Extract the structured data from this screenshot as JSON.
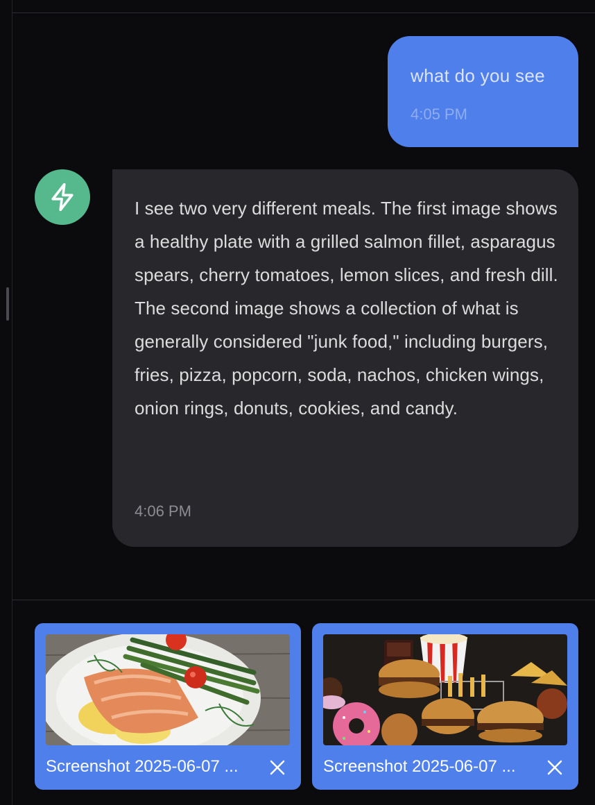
{
  "conversation": {
    "user_message": {
      "text": "what do you see",
      "time": "4:05 PM"
    },
    "assistant_message": {
      "avatar_icon": "lightning-bolt-icon",
      "text": "I see two very different meals. The first image shows a healthy plate with a grilled salmon fillet, asparagus spears, cherry tomatoes, lemon slices, and fresh dill. The second image shows a collection of what is generally considered \"junk food,\" including burgers, fries, pizza, popcorn, soda, nachos, chicken wings, onion rings, donuts, cookies, and candy.",
      "time": "4:06 PM"
    }
  },
  "attachments": [
    {
      "name": "Screenshot 2025-06-07 ...",
      "remove_icon": "close-icon"
    },
    {
      "name": "Screenshot 2025-06-07 ...",
      "remove_icon": "close-icon"
    }
  ],
  "colors": {
    "background": "#0b0b0e",
    "user_bubble": "#4f7fea",
    "assistant_bubble": "#28282c",
    "avatar": "#56b98d",
    "attachment_card": "#4f7fea"
  }
}
